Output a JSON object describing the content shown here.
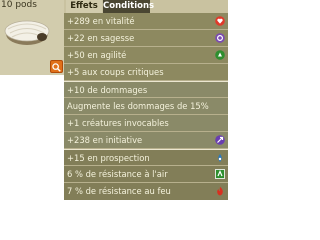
{
  "item": {
    "weight": "10 pods",
    "image_icon": "shell-item-icon"
  },
  "tabs": [
    {
      "label": "Effets",
      "active": false
    },
    {
      "label": "Conditions",
      "active": true
    }
  ],
  "colors": {
    "vitality": "#e03a2a",
    "wisdom": "#7b4bb0",
    "agility": "#2f8f2f",
    "initiative": "#6a3fb0",
    "prospecting": "#2a7ac0",
    "air": "#2f8f2f",
    "fire": "#d83020",
    "search_button": "#e0701a"
  },
  "effects": [
    {
      "label": "+289 en vitalité",
      "icon": "vitality-heart-icon"
    },
    {
      "label": "+22 en sagesse",
      "icon": "wisdom-icon"
    },
    {
      "label": "+50 en agilité",
      "icon": "agility-icon"
    },
    {
      "label": "+5 aux coups critiques",
      "icon": ""
    },
    {
      "label": "+10 de dommages",
      "icon": ""
    },
    {
      "label": "Augmente les dommages de 15%",
      "icon": ""
    },
    {
      "label": "+1 créatures invocables",
      "icon": ""
    },
    {
      "label": "+238 en initiative",
      "icon": "initiative-icon"
    },
    {
      "label": "+15 en prospection",
      "icon": "prospecting-icon"
    },
    {
      "label": "6 % de résistance à l'air",
      "icon": "air-resistance-icon"
    },
    {
      "label": "7 % de résistance au feu",
      "icon": "fire-resistance-icon"
    }
  ],
  "search_button_icon": "magnifier-icon"
}
